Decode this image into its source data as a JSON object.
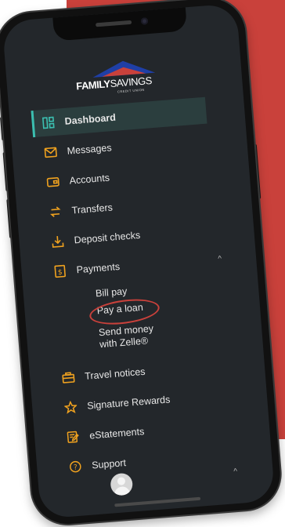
{
  "colors": {
    "accent_red": "#c9413b",
    "screen_bg": "#23272b",
    "active_bg": "#2b3e3e",
    "active_border": "#3bbfb0",
    "icon_orange": "#f0a21f",
    "logo_blue": "#1f3fa6"
  },
  "logo": {
    "family": "FAMILY",
    "savings": "SAVINGS",
    "sub": "CREDIT UNION"
  },
  "nav": {
    "items": [
      {
        "label": "Dashboard",
        "icon": "dashboard-icon",
        "active": true
      },
      {
        "label": "Messages",
        "icon": "envelope-icon"
      },
      {
        "label": "Accounts",
        "icon": "wallet-icon"
      },
      {
        "label": "Transfers",
        "icon": "transfer-arrows-icon"
      },
      {
        "label": "Deposit checks",
        "icon": "download-tray-icon"
      },
      {
        "label": "Payments",
        "icon": "dollar-receipt-icon",
        "expanded": true
      }
    ],
    "payments_sub": [
      {
        "label": "Bill pay"
      },
      {
        "label": "Pay a loan",
        "highlighted": true
      },
      {
        "label": "Send money\nwith Zelle®"
      }
    ],
    "items_after": [
      {
        "label": "Travel notices",
        "icon": "suitcase-icon"
      },
      {
        "label": "Signature Rewards",
        "icon": "star-icon"
      },
      {
        "label": "eStatements",
        "icon": "document-edit-icon"
      },
      {
        "label": "Support",
        "icon": "help-circle-icon"
      }
    ]
  },
  "icons": {
    "chevron_up": "^"
  }
}
